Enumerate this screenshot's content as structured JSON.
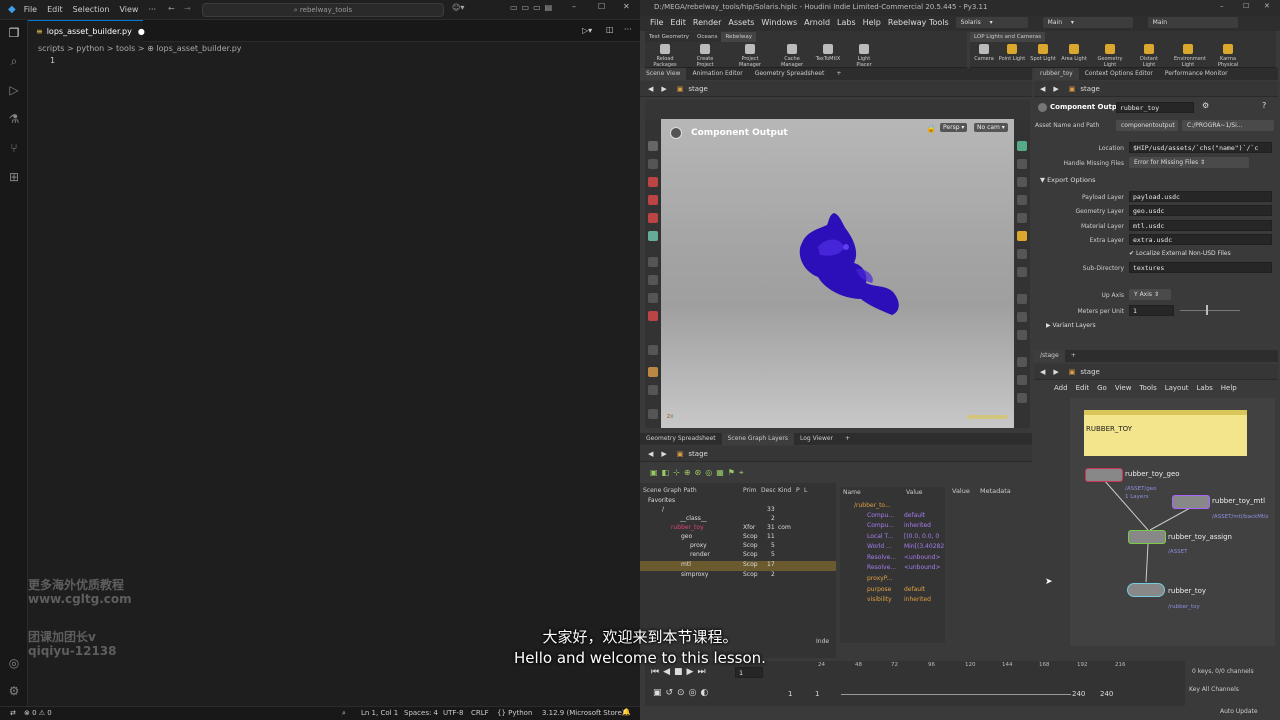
{
  "vscode": {
    "menu": [
      "File",
      "Edit",
      "Selection",
      "View"
    ],
    "search": "rebelway_tools",
    "tab_label": "lops_asset_builder.py",
    "breadcrumb": "scripts > python > tools > ⊕ lops_asset_builder.py",
    "line_number": "1",
    "status": {
      "errors": "⊗ 0 ⚠ 0",
      "position": "Ln 1, Col 1",
      "spaces": "Spaces: 4",
      "encoding": "UTF-8",
      "eol": "CRLF",
      "language": "Python",
      "version": "3.12.9 (Microsoft Store)"
    }
  },
  "houdini": {
    "title": "D:/MEGA/rebelway_tools/hip/Solaris.hiplc - Houdini Indie Limited-Commercial 20.5.445 - Py3.11",
    "menu": [
      "File",
      "Edit",
      "Render",
      "Assets",
      "Windows",
      "Arnold",
      "Labs",
      "Help",
      "Rebelway Tools"
    ],
    "desktop": "Solaris",
    "context_main": "Main",
    "context_main2": "Main",
    "shelf_left_tabs": [
      "Test Geometry",
      "Oceans",
      "Rebelway"
    ],
    "shelf_left_tools": [
      "Reload Packages a...",
      "Create Project",
      "Project Manager",
      "Cache Manager",
      "TexToMtlX",
      "Light Placer Highlight"
    ],
    "shelf_right_tabs": [
      "LOP Lights and Cameras"
    ],
    "shelf_right_tools": [
      "Camera",
      "Point Light",
      "Spot Light",
      "Area Light",
      "Geometry Light",
      "Distant Light",
      "Environment Light",
      "Karma Physical Sky"
    ],
    "pane_tabs_top": [
      "Scene View",
      "Animation Editor",
      "Geometry Spreadsheet"
    ],
    "pane_tabs_right": [
      "rubber_toy",
      "Context Options Editor",
      "Performance Monitor"
    ],
    "path": "stage",
    "viewport": {
      "title": "Component Output",
      "persp": "Persp",
      "cam": "No cam"
    },
    "parm": {
      "node_type": "Component Output",
      "node_name": "rubber_toy",
      "asset_name_label": "Asset Name and Path",
      "asset_name_value": "componentoutput",
      "asset_path": "C:/PROGRA~1/Si...",
      "location_label": "Location",
      "location_value": "$HIP/usd/assets/`chs(\"name\")`/`c",
      "handle_label": "Handle Missing Files",
      "handle_value": "Error for Missing Files",
      "export_options": "Export Options",
      "rows": [
        {
          "label": "Payload Layer",
          "value": "payload.usdc"
        },
        {
          "label": "Geometry Layer",
          "value": "geo.usdc"
        },
        {
          "label": "Material Layer",
          "value": "mtl.usdc"
        },
        {
          "label": "Extra Layer",
          "value": "extra.usdc"
        }
      ],
      "localize": "Localize External Non-USD Files",
      "subdir_label": "Sub-Directory",
      "subdir_value": "textures",
      "upaxis_label": "Up Axis",
      "upaxis_value": "Y Axis",
      "mpu_label": "Meters per Unit",
      "mpu_value": "1",
      "variant_layers": "Variant Layers"
    },
    "network": {
      "tab": "/stage",
      "path": "stage",
      "menu": [
        "Add",
        "Edit",
        "Go",
        "View",
        "Tools",
        "Layout",
        "Labs",
        "Help"
      ],
      "note": "RUBBER_TOY",
      "nodes": [
        {
          "name": "rubber_toy_geo",
          "sub": "/ASSET/geo",
          "sub2": "1 Layers"
        },
        {
          "name": "rubber_toy_mtl",
          "sub": "/ASSET/mtl/backMtls"
        },
        {
          "name": "rubber_toy_assign",
          "sub": "/ASSET"
        },
        {
          "name": "rubber_toy",
          "sub": "/rubber_toy"
        }
      ]
    },
    "bottom_tabs": [
      "Geometry Spreadsheet",
      "Scene Graph Layers",
      "Log Viewer"
    ],
    "scene_graph": {
      "headers": [
        "Scene Graph Path",
        "Prim",
        "Desc",
        "Kind",
        "P",
        "L"
      ],
      "favorites": "Favorites",
      "rows": [
        {
          "path": "/",
          "prim": "",
          "desc": "33",
          "kind": ""
        },
        {
          "path": "__class__",
          "prim": "",
          "desc": "2",
          "kind": ""
        },
        {
          "path": "rubber_toy",
          "prim": "Xfor",
          "desc": "31",
          "kind": "com"
        },
        {
          "path": "geo",
          "prim": "Scop",
          "desc": "11",
          "kind": ""
        },
        {
          "path": "proxy",
          "prim": "Scop",
          "desc": "5",
          "kind": ""
        },
        {
          "path": "render",
          "prim": "Scop",
          "desc": "5",
          "kind": ""
        },
        {
          "path": "mtl",
          "prim": "Scop",
          "desc": "17",
          "kind": ""
        },
        {
          "path": "simproxy",
          "prim": "Scop",
          "desc": "2",
          "kind": ""
        }
      ],
      "footer": "Inde"
    },
    "attrs": {
      "headers": [
        "Name",
        "Value"
      ],
      "prim": "/rubber_to...",
      "rows": [
        {
          "name": "Compu...",
          "value": "default"
        },
        {
          "name": "Compu...",
          "value": "inherited"
        },
        {
          "name": "Local T...",
          "value": "[(0.0, 0.0, 0"
        },
        {
          "name": "World ...",
          "value": "Min[(3.40282"
        },
        {
          "name": "Resolve...",
          "value": "<unbound>"
        },
        {
          "name": "Resolve...",
          "value": "<unbound>"
        },
        {
          "name": "proxyP...",
          "value": ""
        },
        {
          "name": "purpose",
          "value": "default"
        },
        {
          "name": "visibility",
          "value": "inherited"
        }
      ]
    },
    "value_headers": [
      "Value",
      "Metadata"
    ],
    "timeline": {
      "ticks": [
        "1",
        "24",
        "48",
        "72",
        "96",
        "120",
        "144",
        "168",
        "192",
        "216"
      ],
      "frame": "1",
      "start": "1",
      "start2": "1",
      "end": "240",
      "end2": "240",
      "keys": "0 keys, 0/0 channels",
      "key_all": "Key All Channels",
      "auto_update": "Auto Update"
    }
  },
  "subtitle": {
    "zh": "大家好，欢迎来到本节课程。",
    "en": "Hello and welcome to this lesson."
  },
  "watermark": {
    "l1": "更多海外优质教程",
    "l2": "www.cgltg.com",
    "l3": "团课加团长v",
    "l4": "qiqiyu-12138"
  }
}
